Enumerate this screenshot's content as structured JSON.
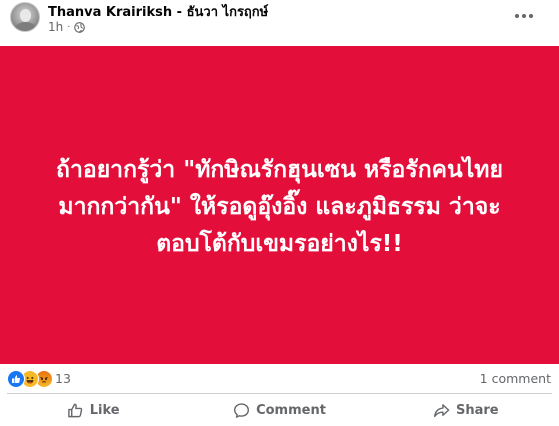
{
  "post": {
    "author": "Thanva Krairiksh - ธันวา ไกรฤกษ์",
    "time": "1h",
    "privacy_icon": "globe-icon",
    "content_lines": [
      "ถ้าอยากรู้ว่า \"ทักษิณรักฮุนเซน หรือรักคนไทย",
      "มากกว่ากัน\" ให้รอดูอุ๊งอิ๊ง และภูมิธรรม ว่าจะ",
      "ตอบโต้กับเขมรอย่างไร!!"
    ],
    "background_color": "#e30e3a"
  },
  "reactions": {
    "icons": [
      "like-icon",
      "haha-icon",
      "angry-icon"
    ],
    "count": "13",
    "comments": "1 comment"
  },
  "actions": {
    "like": "Like",
    "comment": "Comment",
    "share": "Share"
  }
}
